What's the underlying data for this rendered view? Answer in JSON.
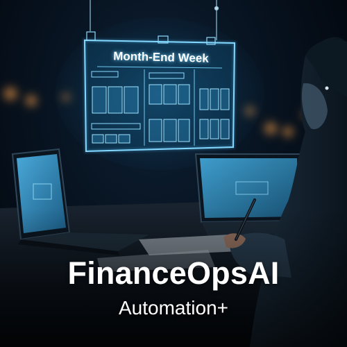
{
  "hologram": {
    "title": "Month-End Week",
    "glow_color": "#7fd8ff"
  },
  "branding": {
    "name": "FinanceOpsAI",
    "tagline": "Automation+"
  },
  "colors": {
    "background": "#06101c",
    "accent": "#45b8f0",
    "text": "#ffffff"
  }
}
